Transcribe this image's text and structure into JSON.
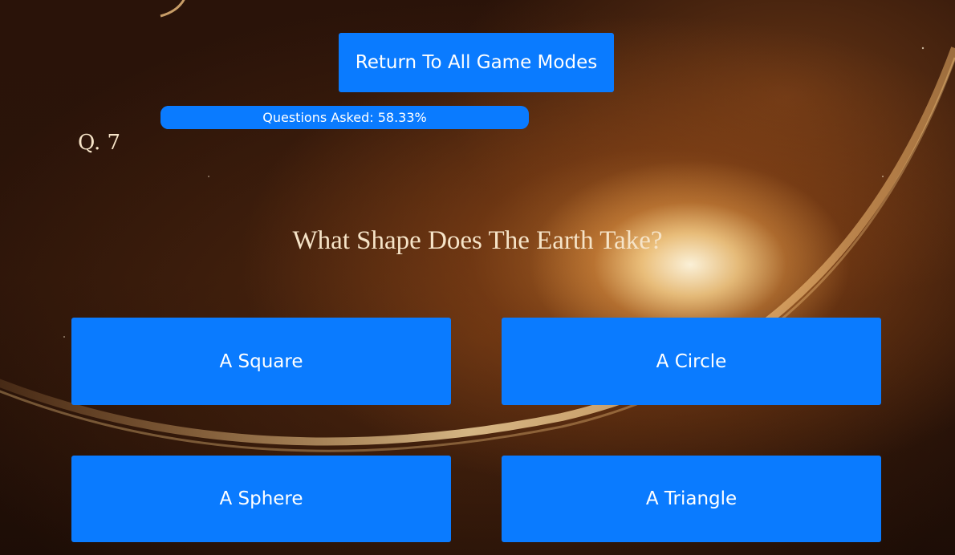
{
  "header": {
    "return_label": "Return To All Game Modes"
  },
  "progress": {
    "label": "Questions Asked: 58.33%",
    "percent": 58.33
  },
  "question": {
    "number": "Q. 7",
    "text": "What Shape Does The Earth Take?"
  },
  "answers": [
    {
      "label": "A Square"
    },
    {
      "label": "A Circle"
    },
    {
      "label": "A Sphere"
    },
    {
      "label": "A Triangle"
    }
  ],
  "colors": {
    "button": "#0a7bff",
    "text_light": "#f6e4c8"
  }
}
